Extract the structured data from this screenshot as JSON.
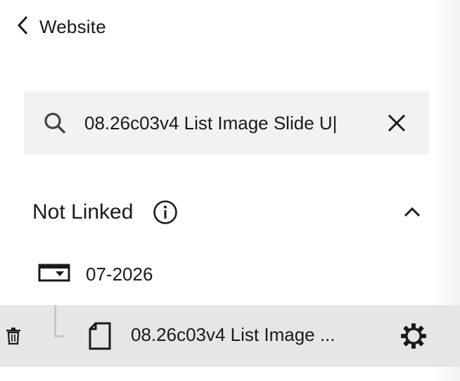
{
  "header": {
    "back_label": "Website"
  },
  "search": {
    "value": "08.26c03v4 List Image Slide U|"
  },
  "section": {
    "title": "Not Linked"
  },
  "folder": {
    "label": "07-2026"
  },
  "page_item": {
    "label": "08.26c03v4 List Image ..."
  },
  "icons": {
    "back": "chevron-left-icon",
    "search": "search-icon",
    "clear": "close-icon",
    "info": "info-icon",
    "collapse": "chevron-up-icon",
    "folder": "folder-dropdown-icon",
    "trash": "trash-icon",
    "doc": "page-icon",
    "gear": "gear-icon"
  }
}
